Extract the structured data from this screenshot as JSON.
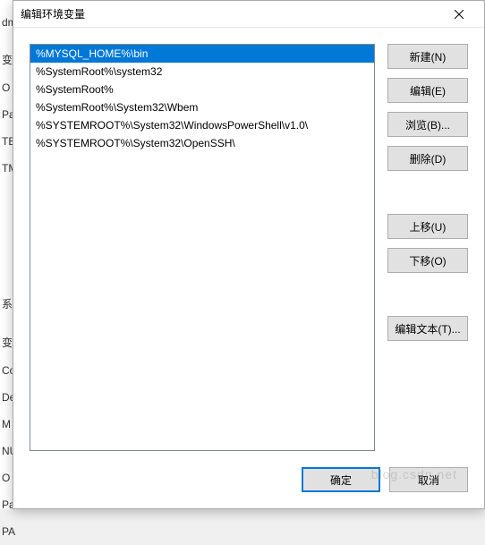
{
  "dialog": {
    "title": "编辑环境变量"
  },
  "list": {
    "items": [
      "%MYSQL_HOME%\\bin",
      "%SystemRoot%\\system32",
      "%SystemRoot%",
      "%SystemRoot%\\System32\\Wbem",
      "%SYSTEMROOT%\\System32\\WindowsPowerShell\\v1.0\\",
      "%SYSTEMROOT%\\System32\\OpenSSH\\"
    ],
    "selected_index": 0
  },
  "buttons": {
    "new": "新建(N)",
    "edit": "编辑(E)",
    "browse": "浏览(B)...",
    "delete": "删除(D)",
    "move_up": "上移(U)",
    "move_down": "下移(O)",
    "edit_text": "编辑文本(T)...",
    "ok": "确定",
    "cancel": "取消"
  },
  "background": {
    "labels": [
      "dm",
      "变",
      "O",
      "Pa",
      "TE",
      "TM",
      "系统",
      "变",
      "Co",
      "De",
      "M",
      "NU",
      "O",
      "Pa",
      "PA"
    ]
  },
  "watermark": "blog.csdn.net"
}
